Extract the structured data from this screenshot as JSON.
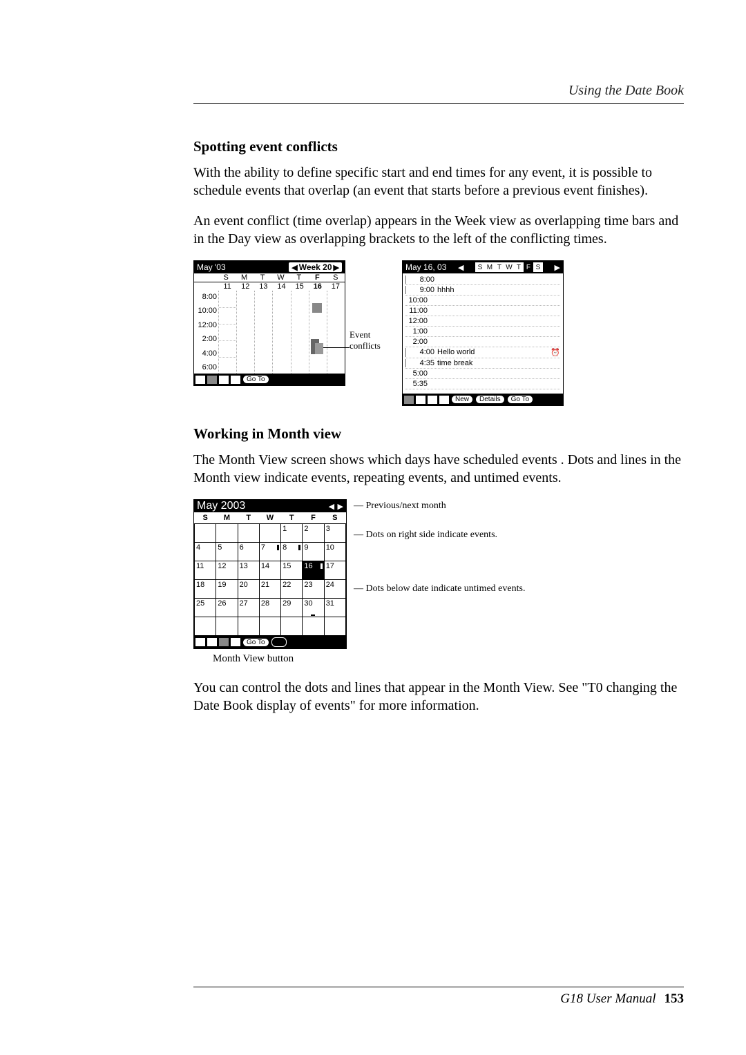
{
  "header": {
    "section_title": "Using the Date Book"
  },
  "section1": {
    "heading": "Spotting event conflicts",
    "para1": "With the ability to define specific start and end times for any event, it is possible to schedule events that overlap (an event that starts before a previous event finishes).",
    "para2": "An event conflict (time overlap) appears in the Week view as overlapping time bars and in the Day view as overlapping brackets to the left of the conflicting times."
  },
  "week_view": {
    "title": "May '03",
    "center": "Week 20",
    "dow": [
      "S",
      "M",
      "T",
      "W",
      "T",
      "F",
      "S"
    ],
    "dates": [
      "11",
      "12",
      "13",
      "14",
      "15",
      "16",
      "17"
    ],
    "times": [
      "8:00",
      "10:00",
      "12:00",
      "2:00",
      "4:00",
      "6:00"
    ],
    "buttons": {
      "goto": "Go To"
    },
    "annotation": "Event conflicts"
  },
  "day_view": {
    "title": "May 16, 03",
    "day_letters": [
      "S",
      "M",
      "T",
      "W",
      "T",
      "F",
      "S"
    ],
    "selected_day_index": 5,
    "rows": [
      {
        "t": "8:00",
        "txt": ""
      },
      {
        "t": "9:00",
        "txt": "hhhh"
      },
      {
        "t": "10:00",
        "txt": ""
      },
      {
        "t": "11:00",
        "txt": ""
      },
      {
        "t": "12:00",
        "txt": ""
      },
      {
        "t": "1:00",
        "txt": ""
      },
      {
        "t": "2:00",
        "txt": ""
      },
      {
        "t": "4:00",
        "txt": "Hello world",
        "alarm": true
      },
      {
        "t": "4:35",
        "txt": "time break"
      },
      {
        "t": "5:00",
        "txt": ""
      },
      {
        "t": "5:35",
        "txt": ""
      }
    ],
    "buttons": {
      "new": "New",
      "details": "Details",
      "goto": "Go To"
    }
  },
  "section2": {
    "heading": "Working in Month view",
    "para1": "The Month View screen shows which days have  scheduled events . Dots and lines in the Month view indicate events, repeating events, and untimed events."
  },
  "month_view": {
    "title": "May 2003",
    "dow": [
      "S",
      "M",
      "T",
      "W",
      "T",
      "F",
      "S"
    ],
    "grid": [
      [
        "",
        "",
        "",
        "",
        "1",
        "2",
        "3"
      ],
      [
        "4",
        "5",
        "6",
        "7",
        "8",
        "9",
        "10"
      ],
      [
        "11",
        "12",
        "13",
        "14",
        "15",
        "16",
        "17"
      ],
      [
        "18",
        "19",
        "20",
        "21",
        "22",
        "23",
        "24"
      ],
      [
        "25",
        "26",
        "27",
        "28",
        "29",
        "30",
        "31"
      ]
    ],
    "buttons": {
      "goto": "Go To"
    },
    "ann_prevnext": "Previous/next month",
    "ann_dots_right": "Dots on right side indicate events.",
    "ann_dots_below": "Dots below date indicate untimed events.",
    "caption": "Month View button"
  },
  "section2b": {
    "para2": "You can control the dots and lines that appear in the Month View. See \"T0 changing the Date Book display of events\" for more information."
  },
  "footer": {
    "manual": "G18 User Manual",
    "page": "153"
  }
}
